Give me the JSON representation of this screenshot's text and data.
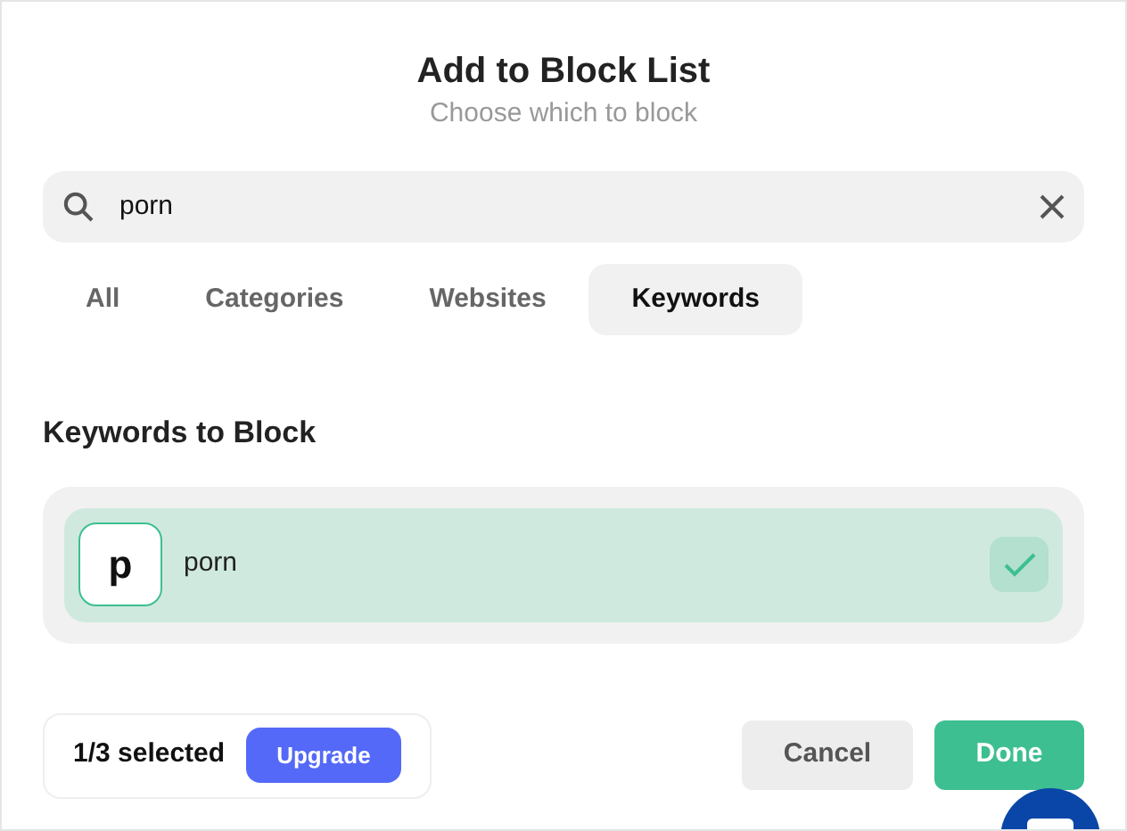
{
  "dialog": {
    "title": "Add to Block List",
    "subtitle": "Choose which to block"
  },
  "search": {
    "value": "porn"
  },
  "tabs": [
    {
      "label": "All",
      "selected": false
    },
    {
      "label": "Categories",
      "selected": false
    },
    {
      "label": "Websites",
      "selected": false
    },
    {
      "label": "Keywords",
      "selected": true
    }
  ],
  "section": {
    "title": "Keywords to Block"
  },
  "items": [
    {
      "initial": "p",
      "label": "porn",
      "checked": true
    }
  ],
  "footer": {
    "count": "1/3 selected",
    "upgrade": "Upgrade",
    "cancel": "Cancel",
    "done": "Done"
  }
}
